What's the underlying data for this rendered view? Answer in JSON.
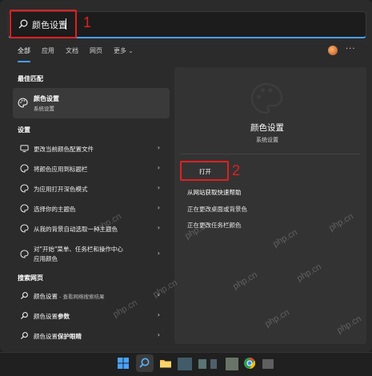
{
  "search": {
    "query": "颜色设置"
  },
  "annotations": {
    "marker1": "1",
    "marker2": "2"
  },
  "tabs": [
    {
      "label": "全部",
      "active": true
    },
    {
      "label": "应用"
    },
    {
      "label": "文档"
    },
    {
      "label": "网页"
    },
    {
      "label": "更多"
    }
  ],
  "more_menu": "···",
  "best_match": {
    "section": "最佳匹配",
    "title": "颜色设置",
    "subtitle": "系统设置"
  },
  "settings": {
    "section": "设置",
    "items": [
      {
        "label": "更改当前颜色配置文件"
      },
      {
        "label": "将颜色应用到标题栏"
      },
      {
        "label": "为应用打开深色模式"
      },
      {
        "label": "选择你的主题色"
      },
      {
        "label": "从我的背景自动选取一种主题色"
      },
      {
        "label_line1": "对\"开始\"菜单、任务栏和操作中心",
        "label_line2": "应用颜色"
      }
    ]
  },
  "web": {
    "section": "搜索网页",
    "items": [
      {
        "label": "颜色设置",
        "suffix": " - 查看网络搜索结果"
      },
      {
        "label": "颜色设置",
        "bold": "参数"
      },
      {
        "label": "颜色设置",
        "bold": "保护眼睛"
      }
    ]
  },
  "preview": {
    "title": "颜色设置",
    "subtitle": "系统设置",
    "actions": [
      {
        "label": "打开"
      },
      {
        "label": "从网站获取快速帮助"
      },
      {
        "label": "正在更改桌面或背景色"
      },
      {
        "label": "正在更改任务栏颜色"
      }
    ]
  },
  "watermark": "php.cn",
  "colors": {
    "accent": "#4a9eff",
    "annotation_red": "#e02020",
    "panel": "#2b2b2b",
    "pane": "#333333"
  }
}
